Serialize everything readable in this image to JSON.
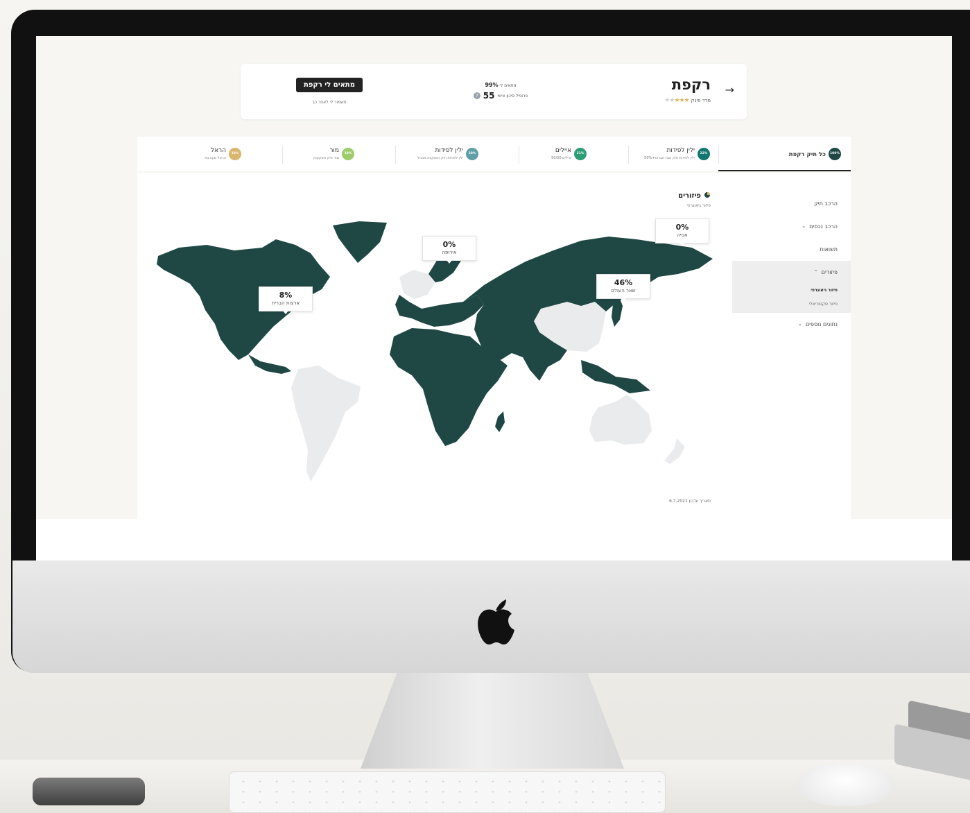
{
  "colors": {
    "map_active": "#1f4845",
    "map_inactive": "#eaebec",
    "accent_dark": "#222222"
  },
  "header": {
    "back_icon": "arrow-right-icon",
    "fund_name": "רקפת",
    "rating_label": "מדד פינק",
    "rating_stars": 3,
    "rating_max": 5,
    "match_label": "מתאים לי",
    "match_value": "99%",
    "risk_label": "פרופיל סיכון אישי",
    "risk_value": "55",
    "cta_label": "מתאים לי רקפת",
    "save_label": "תשמור לי לאחר כך"
  },
  "tracks": [
    {
      "badge": "100%",
      "name": "כל תיק רקפת",
      "desc": "",
      "color": "#1f4845"
    },
    {
      "badge": "22%",
      "name": "ילין לפידות",
      "desc": "ילין לפידות תיק אגח חברות+50%",
      "color": "#12776f"
    },
    {
      "badge": "21%",
      "name": "איילים",
      "desc": "איילים 50/50",
      "color": "#2e9e77"
    },
    {
      "badge": "20%",
      "name": "ילין לפידות",
      "desc": "ילין לפידות תיק השקעות מנוהל",
      "color": "#5f9fa6"
    },
    {
      "badge": "19%",
      "name": "מור",
      "desc": "מור תיק השקעות",
      "color": "#9ccc6b"
    },
    {
      "badge": "18%",
      "name": "הראל",
      "desc": "הראל מעורבת",
      "color": "#d8b66b"
    }
  ],
  "sidenav": {
    "portfolio": "הרכב תיק",
    "assets": "הרכב נכסים",
    "returns": "תשואות",
    "diversification": "פיזורים",
    "geo": "פיזור גיאוגרפי",
    "sector": "פיזור סקטוריאלי",
    "more": "נתונים נוספים"
  },
  "section": {
    "title": "פיזורים",
    "subtitle": "פיזור גיאוגרפי",
    "update": "תאריך עדכון 6.7.2021"
  },
  "regions": [
    {
      "pct": "0%",
      "name": "אסיה"
    },
    {
      "pct": "0%",
      "name": "אירופה"
    },
    {
      "pct": "46%",
      "name": "שאר העולם"
    },
    {
      "pct": "8%",
      "name": "ארצות הברית"
    }
  ]
}
